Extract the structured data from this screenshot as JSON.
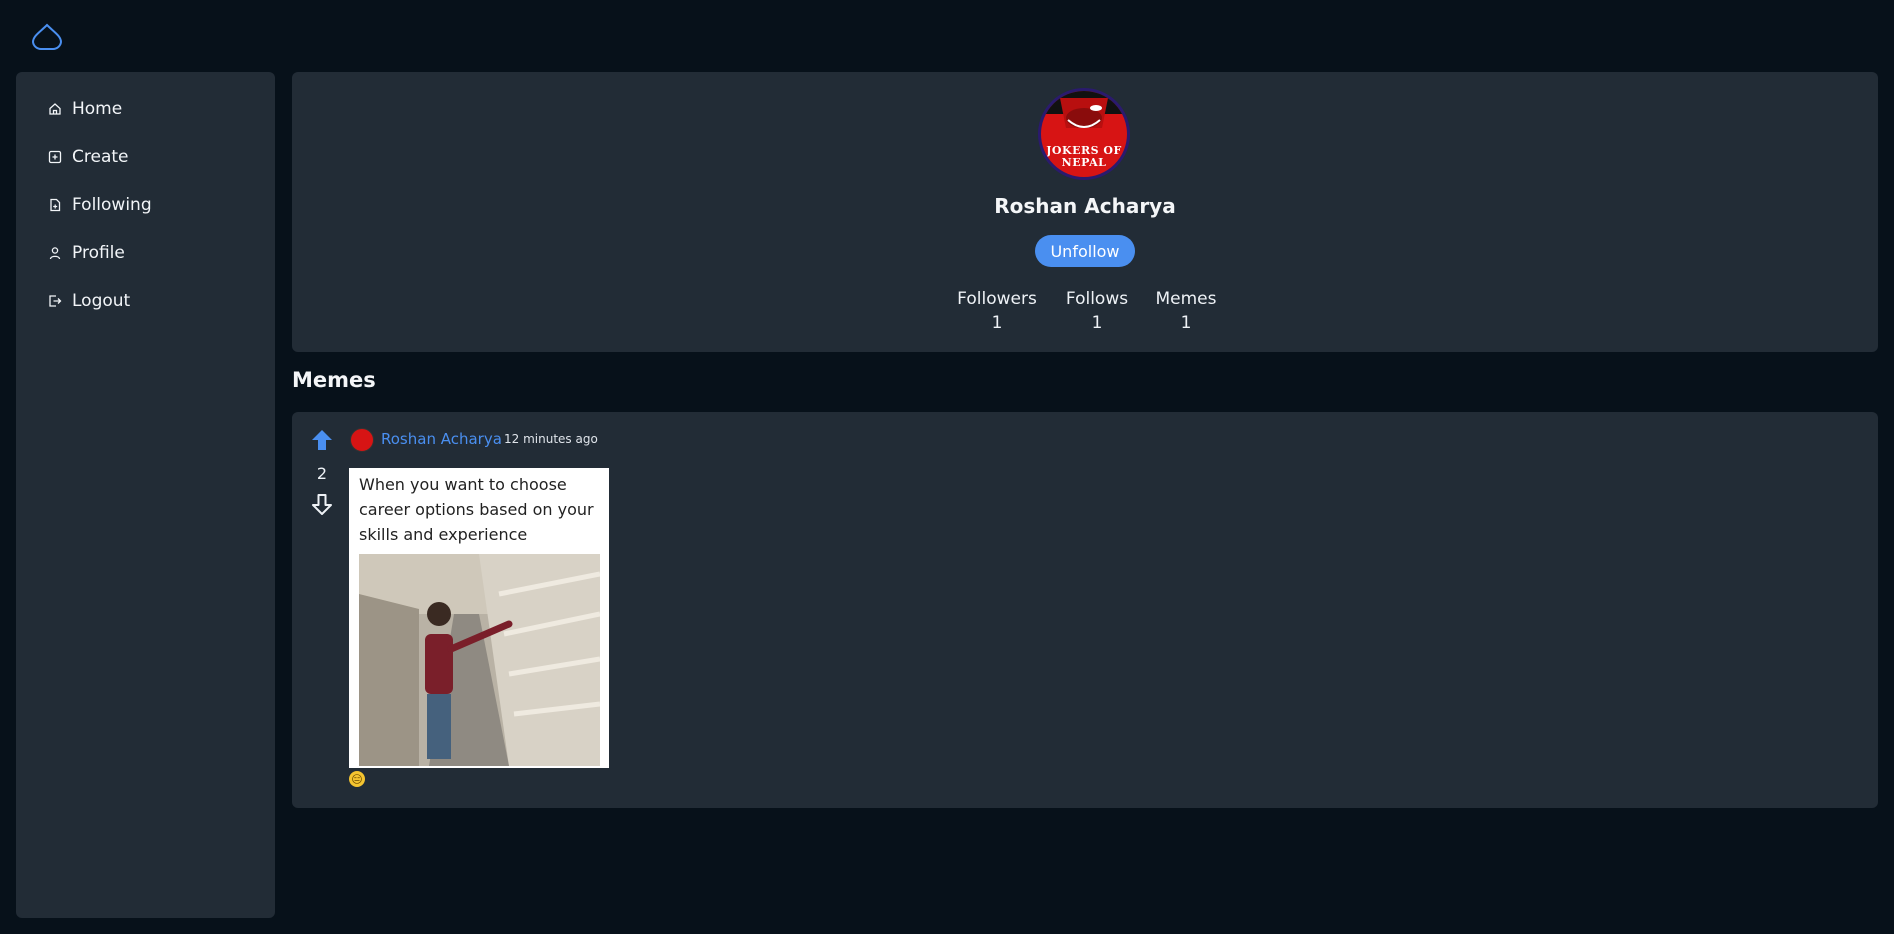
{
  "app": {
    "logo_icon": "cloud-icon",
    "accent_color": "#4a8ff0"
  },
  "sidebar": {
    "items": [
      {
        "label": "Home",
        "icon": "home-icon"
      },
      {
        "label": "Create",
        "icon": "plus-square-icon"
      },
      {
        "label": "Following",
        "icon": "file-plus-icon"
      },
      {
        "label": "Profile",
        "icon": "user-icon"
      },
      {
        "label": "Logout",
        "icon": "logout-icon"
      }
    ]
  },
  "profile": {
    "name": "Roshan Acharya",
    "avatar_text_line1": "JOKERS OF",
    "avatar_text_line2": "NEPAL",
    "unfollow_label": "Unfollow",
    "stats": {
      "followers_label": "Followers",
      "followers_value": "1",
      "follows_label": "Follows",
      "follows_value": "1",
      "memes_label": "Memes",
      "memes_value": "1"
    }
  },
  "memes_section": {
    "title": "Memes"
  },
  "meme": {
    "author": "Roshan Acharya",
    "time": "12 minutes ago",
    "votes": "2",
    "caption": "When you want to choose career options based on your skills and experience",
    "reaction": "😑"
  }
}
